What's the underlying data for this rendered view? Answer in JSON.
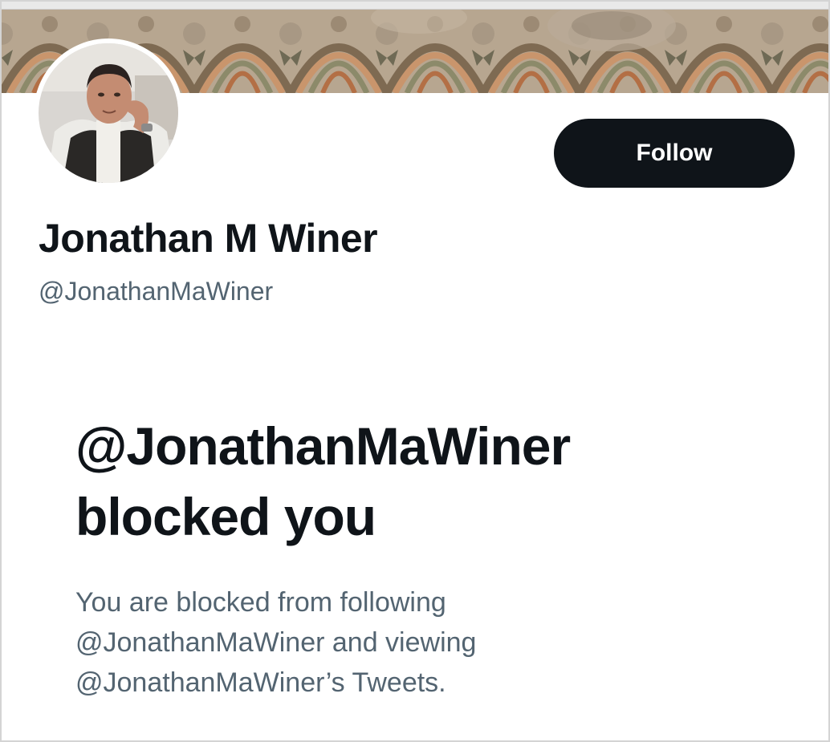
{
  "profile": {
    "display_name": "Jonathan M Winer",
    "handle": "@JonathanMaWiner",
    "follow_label": "Follow"
  },
  "blocked": {
    "title_line1": "@JonathanMaWiner",
    "title_line2": "blocked you",
    "desc_line1": "You are blocked from following",
    "desc_line2": "@JonathanMaWiner and viewing",
    "desc_line3": "@JonathanMaWiner’s Tweets."
  },
  "colors": {
    "primary_text": "#0f1419",
    "secondary_text": "#536471",
    "follow_button_bg": "#0f1419",
    "follow_button_text": "#ffffff"
  },
  "icons": {
    "banner": "mosaic-banner-image",
    "avatar": "profile-avatar-image"
  }
}
